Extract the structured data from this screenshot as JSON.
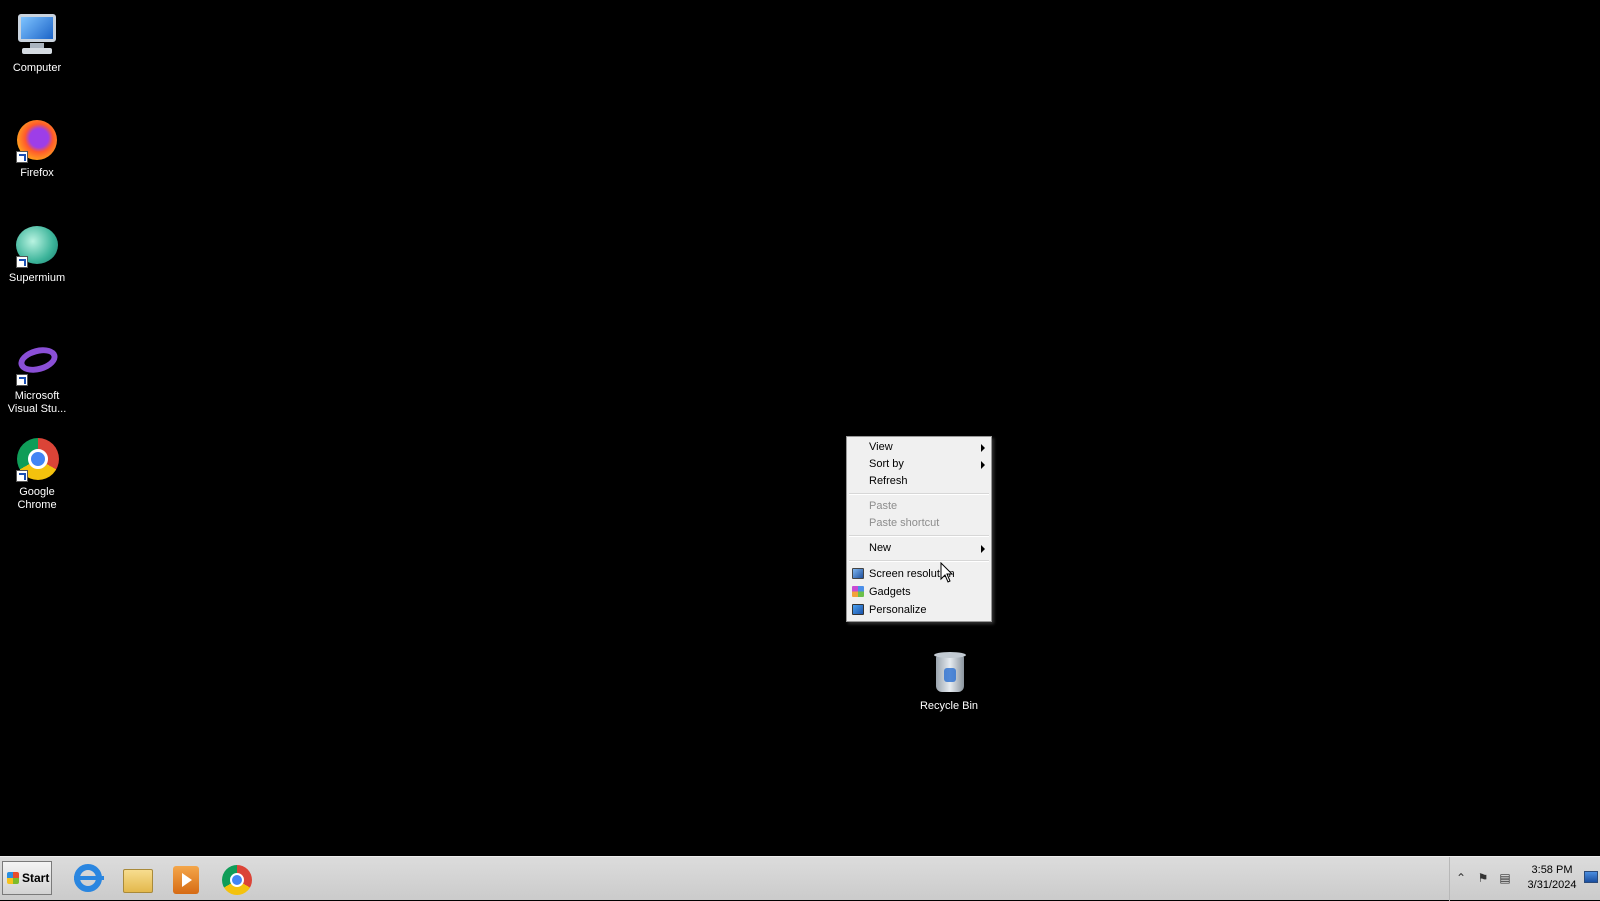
{
  "desktop": {
    "icons": [
      {
        "label": "Computer",
        "icon": "computer-icon"
      },
      {
        "label": "Firefox",
        "icon": "firefox-icon"
      },
      {
        "label": "Supermium",
        "icon": "supermium-icon"
      },
      {
        "label": "Microsoft Visual Stu...",
        "icon": "visual-studio-icon"
      },
      {
        "label": "Google Chrome",
        "icon": "chrome-icon"
      },
      {
        "label": "Recycle Bin",
        "icon": "recycle-bin-icon"
      }
    ]
  },
  "context_menu": {
    "items": [
      {
        "label": "View",
        "submenu": true,
        "enabled": true
      },
      {
        "label": "Sort by",
        "submenu": true,
        "enabled": true
      },
      {
        "label": "Refresh",
        "enabled": true
      },
      {
        "label": "Paste",
        "enabled": false
      },
      {
        "label": "Paste shortcut",
        "enabled": false
      },
      {
        "label": "New",
        "submenu": true,
        "enabled": true
      },
      {
        "label": "Screen resolution",
        "icon": "screen-resolution-icon",
        "enabled": true
      },
      {
        "label": "Gadgets",
        "icon": "gadgets-icon",
        "enabled": true
      },
      {
        "label": "Personalize",
        "icon": "personalize-icon",
        "enabled": true
      }
    ]
  },
  "taskbar": {
    "start_label": "Start",
    "pinned": [
      {
        "name": "Internet Explorer",
        "icon": "internet-explorer-icon"
      },
      {
        "name": "Windows Explorer",
        "icon": "folder-icon"
      },
      {
        "name": "Windows Media Player",
        "icon": "media-player-icon"
      },
      {
        "name": "Google Chrome",
        "icon": "chrome-icon"
      }
    ],
    "tray": {
      "time": "3:58 PM",
      "date": "3/31/2024"
    }
  },
  "colors": {
    "desktop_background": "#000000",
    "taskbar": "#d4d4d4",
    "menu_background": "#f0f0f0",
    "disabled_text": "#8d8d8d"
  }
}
